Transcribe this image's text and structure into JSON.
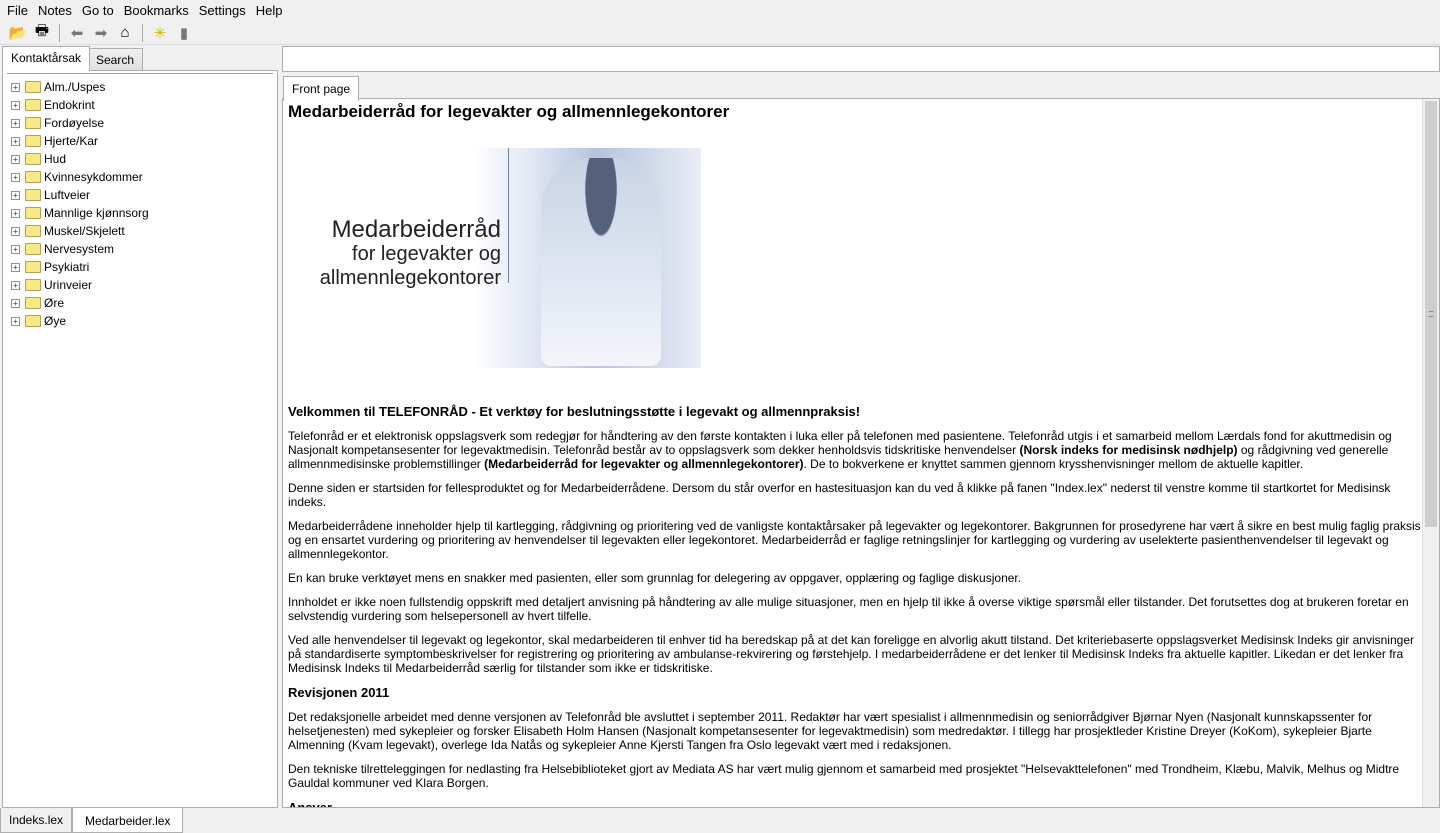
{
  "menu": [
    "File",
    "Notes",
    "Go to",
    "Bookmarks",
    "Settings",
    "Help"
  ],
  "toolbar": {
    "icons": [
      "open-folder-icon",
      "print-icon",
      "back-arrow-icon",
      "forward-arrow-icon",
      "home-icon",
      "new-note-icon",
      "delete-note-icon"
    ]
  },
  "left": {
    "tabs": [
      "Kontaktårsak",
      "Search"
    ],
    "tree": [
      "Alm./Uspes",
      "Endokrint",
      "Fordøyelse",
      "Hjerte/Kar",
      "Hud",
      "Kvinnesykdommer",
      "Luftveier",
      "Mannlige kjønnsorg",
      "Muskel/Skjelett",
      "Nervesystem",
      "Psykiatri",
      "Urinveier",
      "Øre",
      "Øye"
    ]
  },
  "right": {
    "address": "",
    "tab": "Front page"
  },
  "doc": {
    "title": "Medarbeiderråd for legevakter og allmennlegekontorer",
    "hero": {
      "line1": "Medarbeiderråd",
      "line2": "for legevakter og",
      "line3": "allmennlegekontorer"
    },
    "welcome": "Velkommen til TELEFONRÅD - Et verktøy for beslutningsstøtte i legevakt og allmennpraksis!",
    "p1a": "Telefonråd er et elektronisk oppslagsverk som redegjør for håndtering av den første kontakten i luka eller på telefonen med pasientene. Telefonråd utgis i et samarbeid mellom Lærdals fond for akuttmedisin og Nasjonalt kompetansesenter for legevaktmedisin. Telefonråd består av to oppslagsverk som dekker henholdsvis tidskritiske henvendelser ",
    "p1b": "(Norsk indeks for medisinsk nødhjelp)",
    "p1c": " og rådgivning ved generelle allmennmedisinske problemstillinger ",
    "p1d": "(Medarbeiderråd for legevakter og allmennlegekontorer)",
    "p1e": ". De to bokverkene er knyttet sammen gjennom krysshenvisninger mellom de aktuelle kapitler.",
    "p2": "Denne siden er startsiden for fellesproduktet og for Medarbeiderrådene. Dersom du står overfor en hastesituasjon kan du ved å klikke på fanen \"Index.lex\" nederst til venstre komme til startkortet for Medisinsk indeks.",
    "p3": "Medarbeiderrådene inneholder hjelp til kartlegging, rådgivning og prioritering ved de vanligste kontaktårsaker på legevakter og legekontorer. Bakgrunnen for prosedyrene har vært å sikre en best mulig faglig praksis og en ensartet vurdering og prioritering av henvendelser til legevakten eller legekontoret. Medarbeiderråd er faglige retningslinjer for kartlegging og vurdering av uselekterte pasienthenvendelser til legevakt og allmennlegekontor.",
    "p4": "En kan bruke verktøyet mens en snakker med pasienten, eller som grunnlag for delegering av oppgaver, opplæring og faglige diskusjoner.",
    "p5": "Innholdet er ikke noen fullstendig oppskrift med detaljert anvisning på håndtering av alle mulige situasjoner, men en hjelp til ikke å overse viktige spørsmål eller tilstander. Det forutsettes dog at brukeren foretar en selvstendig vurdering som helsepersonell av hvert tilfelle.",
    "p6": "Ved alle henvendelser til legevakt og legekontor, skal medarbeideren til enhver tid ha beredskap på at det kan foreligge en alvorlig akutt tilstand. Det kriteriebaserte oppslagsverket Medisinsk Indeks gir anvisninger på standardiserte symptombeskrivelser for registrering og prioritering av ambulanse-rekvirering og førstehjelp. I medarbeiderrådene er det lenker til Medisinsk Indeks fra aktuelle kapitler. Likedan er det lenker fra Medisinsk Indeks til Medarbeiderråd særlig for tilstander som ikke er tidskritiske.",
    "h_rev": "Revisjonen 2011",
    "p7": "Det redaksjonelle arbeidet med denne versjonen av Telefonråd ble avsluttet i september 2011. Redaktør har vært spesialist i allmennmedisin og seniorrådgiver Bjørnar Nyen (Nasjonalt kunnskapssenter for helsetjenesten) med sykepleier og forsker Elisabeth Holm Hansen (Nasjonalt kompetansesenter for legevaktmedisin) som medredaktør. I tillegg har prosjektleder Kristine Dreyer (KoKom), sykepleier Bjarte Almenning (Kvam legevakt), overlege Ida Natås og sykepleier Anne Kjersti Tangen fra Oslo legevakt vært med i redaksjonen.",
    "p8": "Den tekniske tilretteleggingen for nedlasting fra Helsebiblioteket gjort av Mediata AS har vært mulig gjennom et samarbeid med prosjektet \"Helsevakttelefonen\" med Trondheim, Klæbu, Malvik, Melhus og Midtre Gauldal kommuner ved Klara Borgen.",
    "h_ans": "Ansvar"
  },
  "scroll": {
    "position_percent": 0
  },
  "bottom_tabs": [
    "Indeks.lex",
    "Medarbeider.lex"
  ],
  "active_bottom_tab": "Medarbeider.lex"
}
